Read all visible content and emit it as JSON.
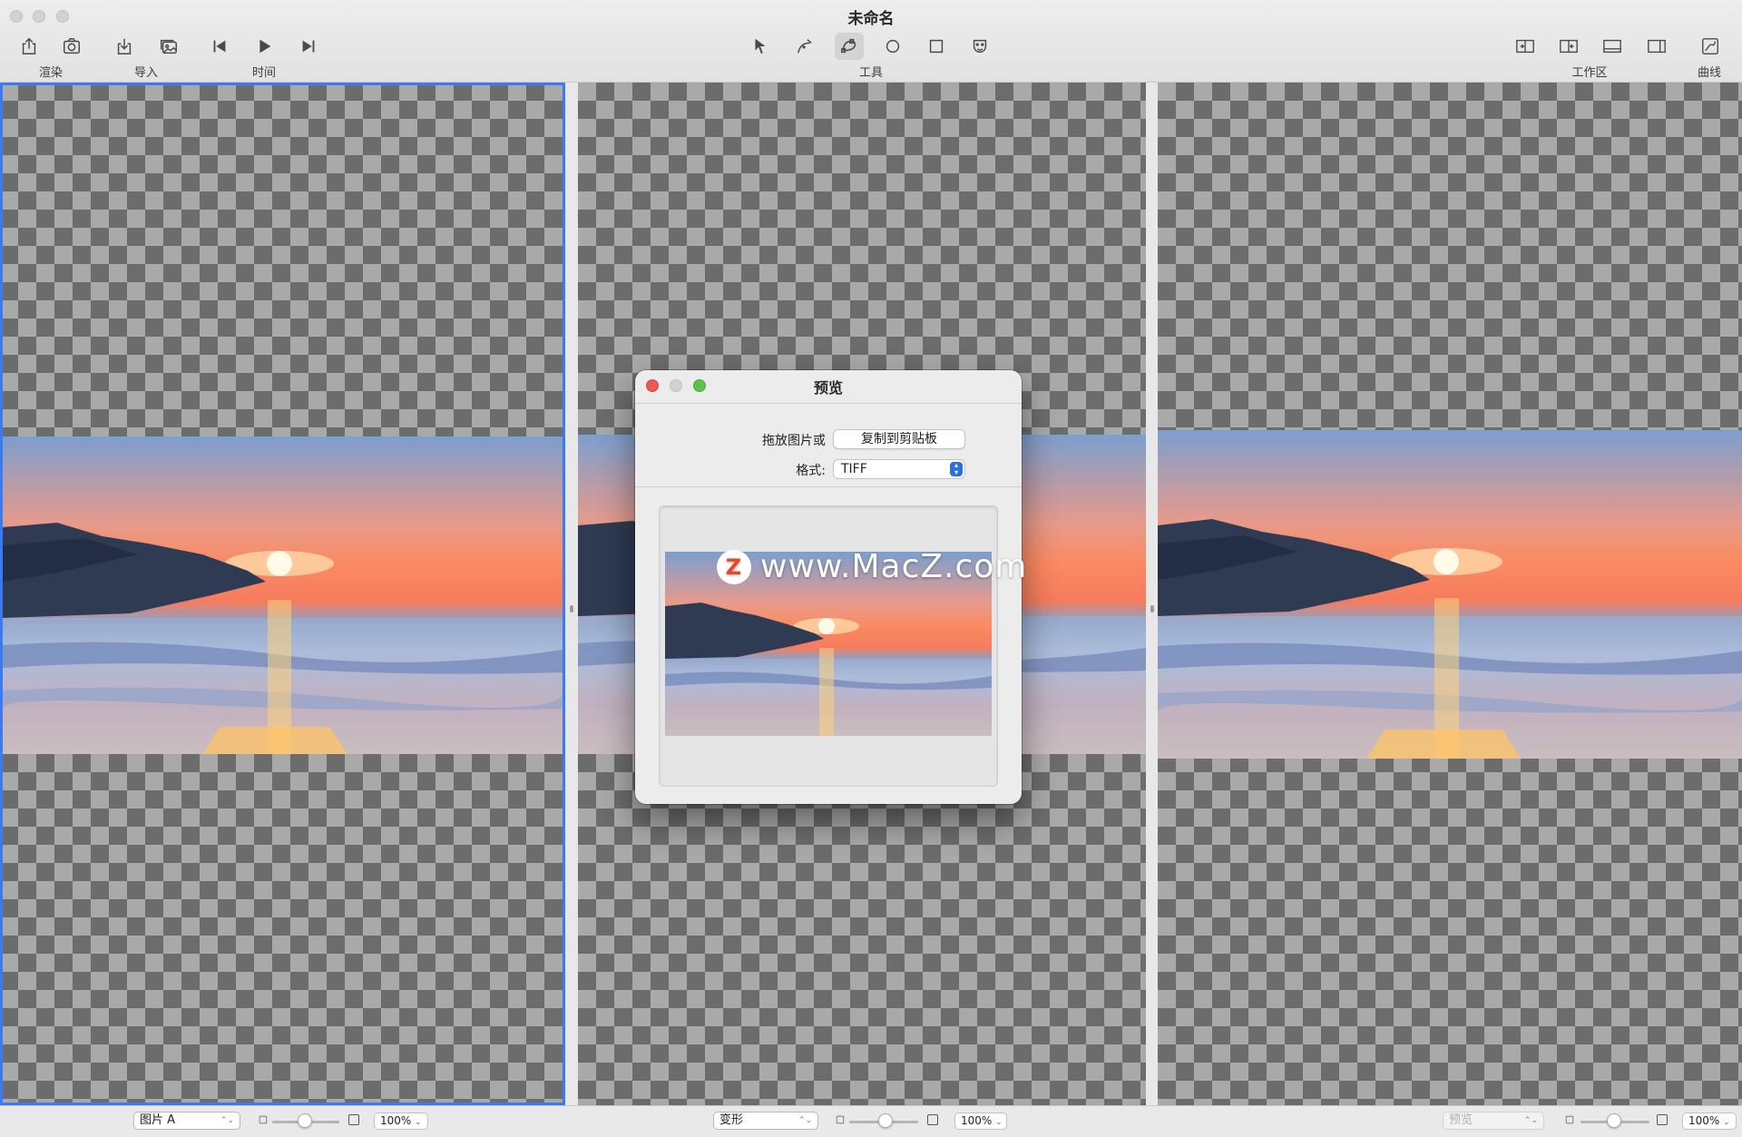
{
  "window": {
    "title": "未命名"
  },
  "toolbar": {
    "labels": {
      "render": "渲染",
      "import": "导入",
      "time": "时间",
      "tools": "工具",
      "workspace": "工作区",
      "curves": "曲线"
    }
  },
  "dialog": {
    "title": "预览",
    "drag_label": "拖放图片或",
    "copy_button": "复制到剪贴板",
    "format_label": "格式:",
    "format_value": "TIFF"
  },
  "watermark": {
    "text": "www.MacZ.com",
    "badge": "Z"
  },
  "panes": [
    {
      "selector": "图片 A",
      "selector_disabled": false,
      "zoom": "100%"
    },
    {
      "selector": "变形",
      "selector_disabled": false,
      "zoom": "100%"
    },
    {
      "selector": "预览",
      "selector_disabled": true,
      "zoom": "100%"
    }
  ],
  "colors": {
    "accent": "#3a7bef",
    "close": "#ec5b52",
    "zoom": "#5dc24b"
  }
}
